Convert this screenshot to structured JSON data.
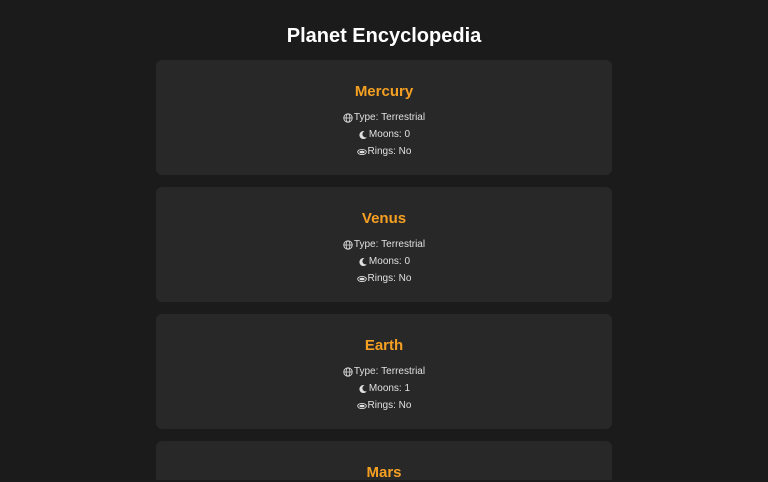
{
  "header": {
    "title": "Planet Encyclopedia"
  },
  "labels": {
    "type": "Type:",
    "moons": "Moons:",
    "rings": "Rings:"
  },
  "colors": {
    "accent": "#f5a023",
    "background": "#1b1b1b",
    "card": "#282828"
  },
  "icons": {
    "type": "globe-icon",
    "moons": "moon-icon",
    "rings": "ring-icon"
  },
  "planets": [
    {
      "name": "Mercury",
      "type": "Terrestrial",
      "moons": "0",
      "rings": "No"
    },
    {
      "name": "Venus",
      "type": "Terrestrial",
      "moons": "0",
      "rings": "No"
    },
    {
      "name": "Earth",
      "type": "Terrestrial",
      "moons": "1",
      "rings": "No"
    },
    {
      "name": "Mars"
    }
  ]
}
